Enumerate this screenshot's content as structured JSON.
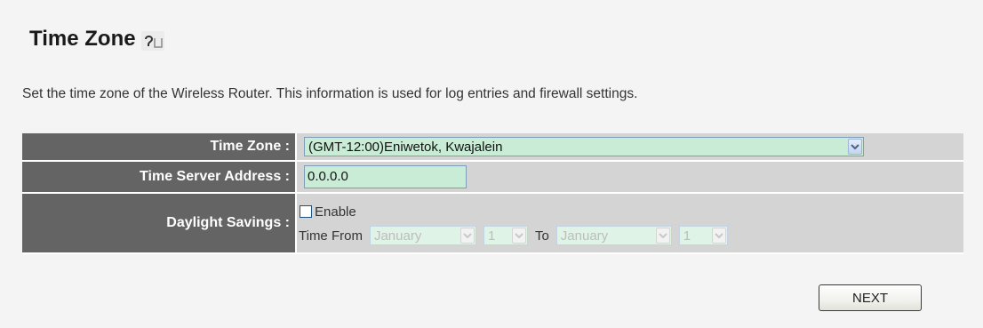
{
  "page": {
    "title": "Time Zone",
    "description": "Set the time zone of the Wireless Router. This information is used for log entries and firewall settings."
  },
  "form": {
    "time_zone": {
      "label": "Time Zone :",
      "value": "(GMT-12:00)Eniwetok, Kwajalein"
    },
    "time_server": {
      "label": "Time Server Address :",
      "value": "0.0.0.0"
    },
    "daylight": {
      "label": "Daylight Savings :",
      "enable_label": "Enable",
      "enabled": false,
      "time_from_label": "Time From",
      "to_label": "To",
      "from_month": "January",
      "from_day": "1",
      "to_month": "January",
      "to_day": "1"
    }
  },
  "buttons": {
    "next": "NEXT"
  },
  "colors": {
    "label_bg": "#646464",
    "value_bg": "#d4d4d4",
    "field_bg": "#c9ecd6",
    "page_bg": "#f4f4f4"
  },
  "icons": {
    "help": "help-icon",
    "dropdown": "chevron-down-icon"
  }
}
